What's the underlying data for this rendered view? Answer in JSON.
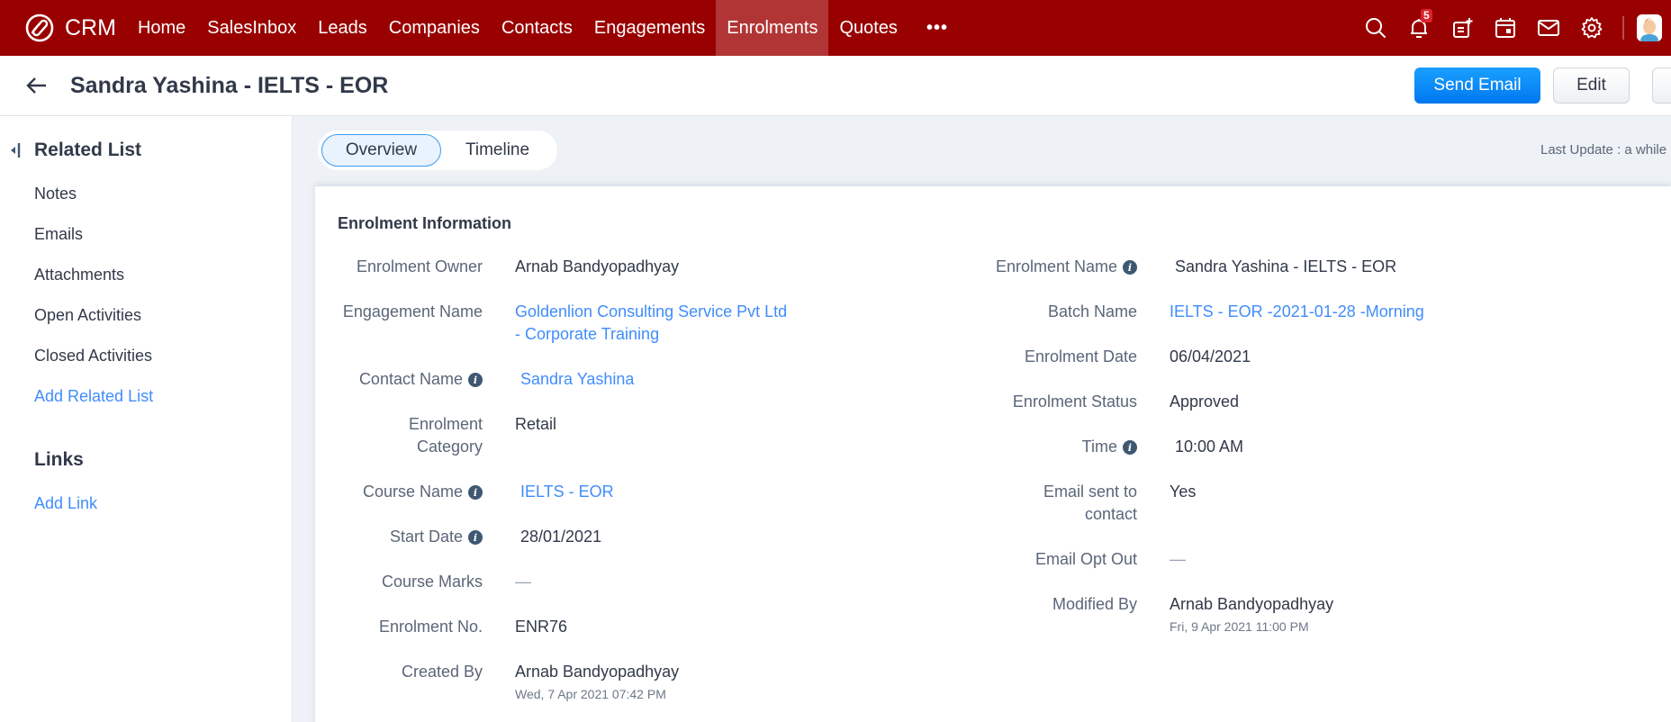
{
  "topnav": {
    "brand": "CRM",
    "tabs": [
      {
        "label": "Home",
        "active": false
      },
      {
        "label": "SalesInbox",
        "active": false
      },
      {
        "label": "Leads",
        "active": false
      },
      {
        "label": "Companies",
        "active": false
      },
      {
        "label": "Contacts",
        "active": false
      },
      {
        "label": "Engagements",
        "active": false
      },
      {
        "label": "Enrolments",
        "active": true
      },
      {
        "label": "Quotes",
        "active": false
      }
    ],
    "more_label": "•••",
    "notification_count": "5",
    "icons": [
      "search-icon",
      "bell-icon",
      "add-note-icon",
      "calendar-icon",
      "mail-icon",
      "gear-icon",
      "avatar"
    ],
    "colors": {
      "nav_bg": "#990000",
      "active_tab_bg": "#b13535"
    }
  },
  "header": {
    "title": "Sandra Yashina - IELTS - EOR",
    "send_email_label": "Send Email",
    "edit_label": "Edit"
  },
  "sidebar": {
    "related_list_title": "Related List",
    "items": [
      {
        "label": "Notes"
      },
      {
        "label": "Emails"
      },
      {
        "label": "Attachments"
      },
      {
        "label": "Open Activities"
      },
      {
        "label": "Closed Activities"
      }
    ],
    "add_related_list": "Add Related List",
    "links_title": "Links",
    "add_link": "Add Link"
  },
  "main": {
    "tabs": [
      {
        "label": "Overview",
        "active": true
      },
      {
        "label": "Timeline",
        "active": false
      }
    ],
    "last_update": "Last Update : a while",
    "section_title": "Enrolment Information",
    "left_fields": [
      {
        "label": "Enrolment Owner",
        "value": "Arnab Bandyopadhyay"
      },
      {
        "label": "Engagement Name",
        "value": "Goldenlion Consulting Service Pvt Ltd - Corporate Training",
        "value_line1": "Goldenlion Consulting Service Pvt Ltd",
        "value_line2": "- Corporate Training"
      },
      {
        "label": "Contact Name",
        "value": "Sandra Yashina",
        "info": true
      },
      {
        "label": "Enrolment Category",
        "label_line1": "Enrolment",
        "label_line2": "Category",
        "value": "Retail"
      },
      {
        "label": "Course Name",
        "value": "IELTS - EOR",
        "info": true
      },
      {
        "label": "Start Date",
        "value": "28/01/2021",
        "info": true
      },
      {
        "label": "Course Marks",
        "value": "—"
      },
      {
        "label": "Enrolment No.",
        "value": "ENR76"
      },
      {
        "label": "Created By",
        "value": "Arnab Bandyopadhyay",
        "sub": "Wed, 7 Apr 2021 07:42 PM"
      }
    ],
    "right_fields": [
      {
        "label": "Enrolment Name",
        "value": "Sandra Yashina - IELTS - EOR",
        "info": true
      },
      {
        "label": "Batch Name",
        "value": "IELTS - EOR -2021-01-28 -Morning"
      },
      {
        "label": "Enrolment Date",
        "value": "06/04/2021"
      },
      {
        "label": "Enrolment Status",
        "value": "Approved"
      },
      {
        "label": "Time",
        "value": "10:00 AM",
        "info": true
      },
      {
        "label": "Email sent to contact",
        "label_line1": "Email sent to",
        "label_line2": "contact",
        "value": "Yes"
      },
      {
        "label": "Email Opt Out",
        "value": "—"
      },
      {
        "label": "Modified By",
        "value": "Arnab Bandyopadhyay",
        "sub": "Fri, 9 Apr 2021 11:00 PM"
      }
    ]
  },
  "colors": {
    "link": "#408dfb",
    "primary_button": "#0a84f5",
    "content_bg": "#eef2f6"
  }
}
